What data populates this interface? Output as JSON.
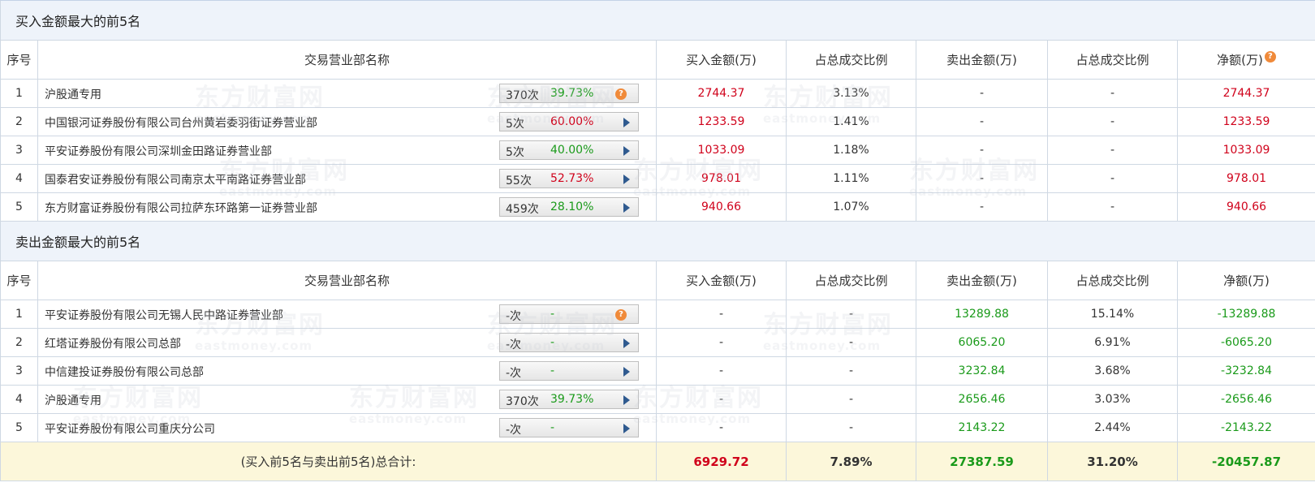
{
  "buy_section": {
    "title": "买入金额最大的前5名",
    "headers": {
      "seq": "序号",
      "name": "交易营业部名称",
      "buy": "买入金额(万)",
      "buy_ratio": "占总成交比例",
      "sell": "卖出金额(万)",
      "sell_ratio": "占总成交比例",
      "net": "净额(万)"
    },
    "rows": [
      {
        "seq": "1",
        "name": "沪股通专用",
        "count": "370次",
        "pct": "39.73%",
        "buy": "2744.37",
        "buy_ratio": "3.13%",
        "sell": "-",
        "sell_ratio": "-",
        "net": "2744.37"
      },
      {
        "seq": "2",
        "name": "中国银河证券股份有限公司台州黄岩委羽街证券营业部",
        "count": "5次",
        "pct": "60.00%",
        "buy": "1233.59",
        "buy_ratio": "1.41%",
        "sell": "-",
        "sell_ratio": "-",
        "net": "1233.59"
      },
      {
        "seq": "3",
        "name": "平安证券股份有限公司深圳金田路证券营业部",
        "count": "5次",
        "pct": "40.00%",
        "buy": "1033.09",
        "buy_ratio": "1.18%",
        "sell": "-",
        "sell_ratio": "-",
        "net": "1033.09"
      },
      {
        "seq": "4",
        "name": "国泰君安证券股份有限公司南京太平南路证券营业部",
        "count": "55次",
        "pct": "52.73%",
        "buy": "978.01",
        "buy_ratio": "1.11%",
        "sell": "-",
        "sell_ratio": "-",
        "net": "978.01"
      },
      {
        "seq": "5",
        "name": "东方财富证券股份有限公司拉萨东环路第一证券营业部",
        "count": "459次",
        "pct": "28.10%",
        "buy": "940.66",
        "buy_ratio": "1.07%",
        "sell": "-",
        "sell_ratio": "-",
        "net": "940.66"
      }
    ]
  },
  "sell_section": {
    "title": "卖出金额最大的前5名",
    "headers": {
      "seq": "序号",
      "name": "交易营业部名称",
      "buy": "买入金额(万)",
      "buy_ratio": "占总成交比例",
      "sell": "卖出金额(万)",
      "sell_ratio": "占总成交比例",
      "net": "净额(万)"
    },
    "rows": [
      {
        "seq": "1",
        "name": "平安证券股份有限公司无锡人民中路证券营业部",
        "count": "-次",
        "pct": "-",
        "buy": "-",
        "buy_ratio": "-",
        "sell": "13289.88",
        "sell_ratio": "15.14%",
        "net": "-13289.88"
      },
      {
        "seq": "2",
        "name": "红塔证券股份有限公司总部",
        "count": "-次",
        "pct": "-",
        "buy": "-",
        "buy_ratio": "-",
        "sell": "6065.20",
        "sell_ratio": "6.91%",
        "net": "-6065.20"
      },
      {
        "seq": "3",
        "name": "中信建投证券股份有限公司总部",
        "count": "-次",
        "pct": "-",
        "buy": "-",
        "buy_ratio": "-",
        "sell": "3232.84",
        "sell_ratio": "3.68%",
        "net": "-3232.84"
      },
      {
        "seq": "4",
        "name": "沪股通专用",
        "count": "370次",
        "pct": "39.73%",
        "buy": "-",
        "buy_ratio": "-",
        "sell": "2656.46",
        "sell_ratio": "3.03%",
        "net": "-2656.46"
      },
      {
        "seq": "5",
        "name": "平安证券股份有限公司重庆分公司",
        "count": "-次",
        "pct": "-",
        "buy": "-",
        "buy_ratio": "-",
        "sell": "2143.22",
        "sell_ratio": "2.44%",
        "net": "-2143.22"
      }
    ]
  },
  "total": {
    "label": "(买入前5名与卖出前5名)总合计:",
    "buy": "6929.72",
    "buy_ratio": "7.89%",
    "sell": "27387.59",
    "sell_ratio": "31.20%",
    "net": "-20457.87"
  },
  "help_icon_glyph": "?",
  "watermark": {
    "cn": "东方财富网",
    "en": "eastmoney.com"
  },
  "colors": {
    "positive": "#d0021b",
    "negative": "#1a9a1a",
    "pct_buy": "#d0021b",
    "pct_other": "#1a9a1a"
  }
}
